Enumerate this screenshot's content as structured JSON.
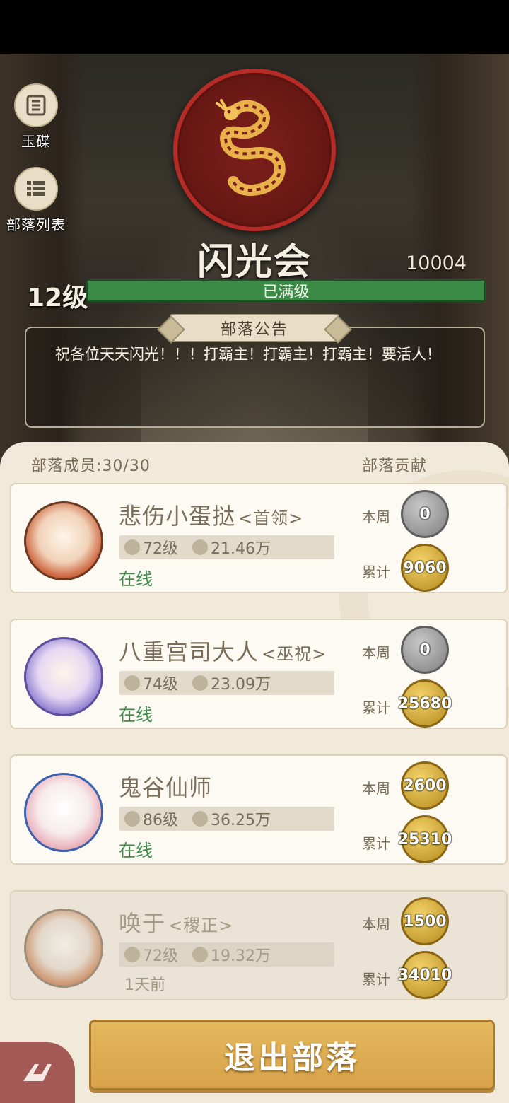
{
  "side_menu": [
    {
      "label": "玉碟",
      "icon": "list-book-icon"
    },
    {
      "label": "部落列表",
      "icon": "list-icon"
    }
  ],
  "guild": {
    "name": "闪光会",
    "id": "10004",
    "level": "12级",
    "level_status": "已满级",
    "emblem": "dragon-emblem"
  },
  "notice": {
    "title": "部落公告",
    "text": "祝各位天天闪光！！！打霸主！打霸主！打霸主！要活人！"
  },
  "members": {
    "label": "部落成员:30/30",
    "contrib_label": "部落贡献",
    "weekly_label": "本周",
    "total_label": "累计",
    "list": [
      {
        "name": "悲伤小蛋挞",
        "role": "<首领>",
        "level": "72级",
        "power": "21.46万",
        "status": "在线",
        "weekly": "0",
        "total": "9060"
      },
      {
        "name": "八重宫司大人",
        "role": "<巫祝>",
        "level": "74级",
        "power": "23.09万",
        "status": "在线",
        "weekly": "0",
        "total": "25680"
      },
      {
        "name": "鬼谷仙师",
        "role": "",
        "level": "86级",
        "power": "36.25万",
        "status": "在线",
        "weekly": "2600",
        "total": "25310"
      },
      {
        "name": "唤于",
        "role": "<稷正>",
        "level": "72级",
        "power": "19.32万",
        "status": "1天前",
        "weekly": "1500",
        "total": "34010"
      }
    ]
  },
  "exit_button": "退出部落",
  "colors": {
    "accent_gold": "#d7a24a",
    "online_green": "#3e8a49",
    "emblem_red": "#b52c26"
  }
}
